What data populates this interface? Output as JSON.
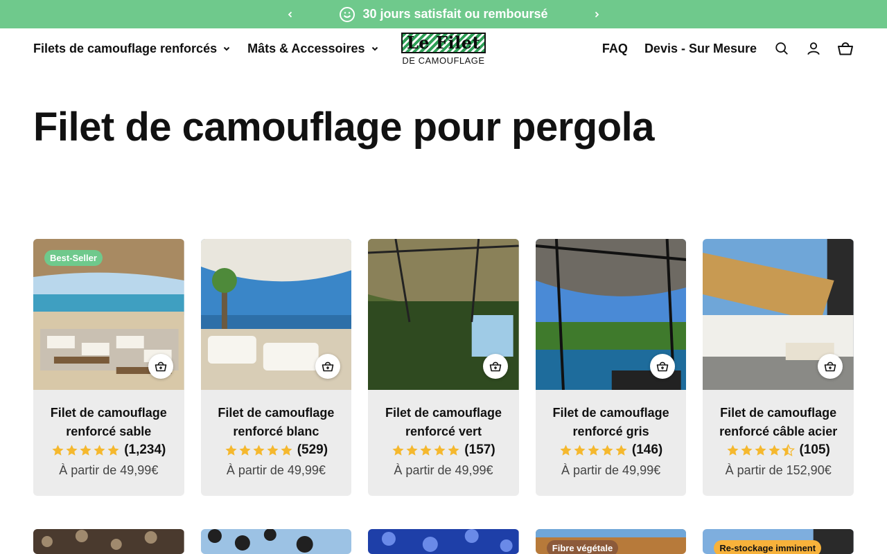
{
  "announcement": {
    "text": "30 jours satisfait ou remboursé",
    "icon": "smile-icon",
    "bg_color": "#6fc98c"
  },
  "header": {
    "nav_left": [
      {
        "label": "Filets de camouflage renforcés",
        "has_dropdown": true
      },
      {
        "label": "Mâts & Accessoires",
        "has_dropdown": true
      }
    ],
    "logo": {
      "title": "Le Filet",
      "subtitle": "DE CAMOUFLAGE"
    },
    "nav_right": [
      {
        "label": "FAQ"
      },
      {
        "label": "Devis - Sur Mesure"
      }
    ],
    "icons": [
      "search-icon",
      "account-icon",
      "cart-icon"
    ]
  },
  "page": {
    "title": "Filet de camouflage pour pergola"
  },
  "products": [
    {
      "name": "Filet de camouflage renforcé sable",
      "rating": 5,
      "reviews": "(1,234)",
      "price": "À partir de 49,99€",
      "badge": "Best-Seller"
    },
    {
      "name": "Filet de camouflage renforcé blanc",
      "rating": 5,
      "reviews": "(529)",
      "price": "À partir de 49,99€",
      "badge": ""
    },
    {
      "name": "Filet de camouflage renforcé vert",
      "rating": 5,
      "reviews": "(157)",
      "price": "À partir de 49,99€",
      "badge": ""
    },
    {
      "name": "Filet de camouflage renforcé gris",
      "rating": 5,
      "reviews": "(146)",
      "price": "À partir de 49,99€",
      "badge": ""
    },
    {
      "name": "Filet de camouflage renforcé câble acier",
      "rating": 4.5,
      "reviews": "(105)",
      "price": "À partir de 152,90€",
      "badge": ""
    }
  ],
  "products_row2": [
    {
      "badge": ""
    },
    {
      "badge": ""
    },
    {
      "badge": ""
    },
    {
      "badge": "Fibre végétale"
    },
    {
      "badge": "Re-stockage imminent"
    }
  ],
  "colors": {
    "accent_green": "#6fc98c",
    "star_gold": "#f5b82e",
    "card_bg": "#ececec"
  }
}
